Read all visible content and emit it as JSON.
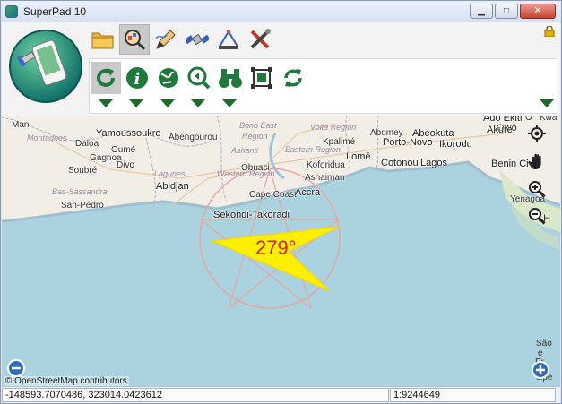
{
  "window": {
    "title": "SuperPad 10"
  },
  "toolbar": {
    "tabs": [
      {
        "name": "folder-icon"
      },
      {
        "name": "search-map-icon",
        "active": true
      },
      {
        "name": "draw-pencil-icon"
      },
      {
        "name": "satellite-icon"
      },
      {
        "name": "survey-instrument-icon"
      },
      {
        "name": "tools-icon"
      }
    ],
    "tools": [
      {
        "name": "refresh-arrow-icon",
        "active": true
      },
      {
        "name": "info-icon"
      },
      {
        "name": "globe-icon"
      },
      {
        "name": "zoom-previous-icon"
      },
      {
        "name": "binoculars-icon"
      },
      {
        "name": "zoom-extent-icon"
      },
      {
        "name": "sync-icon"
      }
    ]
  },
  "map": {
    "attribution": "© OpenStreetMap contributors",
    "heading": "279°",
    "labels": {
      "man": "Man",
      "montagnes": "Montagnes",
      "yamoussoukro": "Yamoussoukro",
      "abengourou": "Abengourou",
      "daloa": "Daloa",
      "gagnoa": "Gagnoa",
      "oume": "Oumé",
      "divo": "Divo",
      "soubre": "Soubré",
      "lagunes": "Lagunes",
      "bas_sassandra": "Bas-Sassandra",
      "abidjan": "Abidjan",
      "san_pedro": "San-Pédro",
      "region1": "Region",
      "bono_east": "Bono East",
      "volta_region": "Volta Region",
      "kpalime": "Kpalimé",
      "eastern_region": "Eastern Region",
      "ashanti": "Ashanti",
      "western_region": "Western Region",
      "obuasi": "Obuasi",
      "koforidua": "Koforidua",
      "ashaiman": "Ashaiman",
      "cape_coast": "Cape Coast",
      "accra": "Accra",
      "sekondi": "Sekondi-Takoradi",
      "lome": "Lomé",
      "abomey": "Abomey",
      "porto_novo": "Porto-Novo",
      "cotonou": "Cotonou",
      "lagos": "Lagos",
      "abeokuta": "Abeokuta",
      "ikorodu": "Ikorodu",
      "ado_ekiti": "Ado Ekiti",
      "owo": "Owo",
      "akure": "Akure",
      "benin_city": "Benin Ci",
      "yenagoa": "Yenagoa",
      "portharcourt": "t H",
      "o": "O",
      "kwa": "Kwa",
      "sao": "São",
      "e": "e",
      "pr": "Pr",
      "cipe": "cipe"
    }
  },
  "status": {
    "coordinates": "-148593.7070486, 323014.0423612",
    "scale": "1:9244649"
  }
}
